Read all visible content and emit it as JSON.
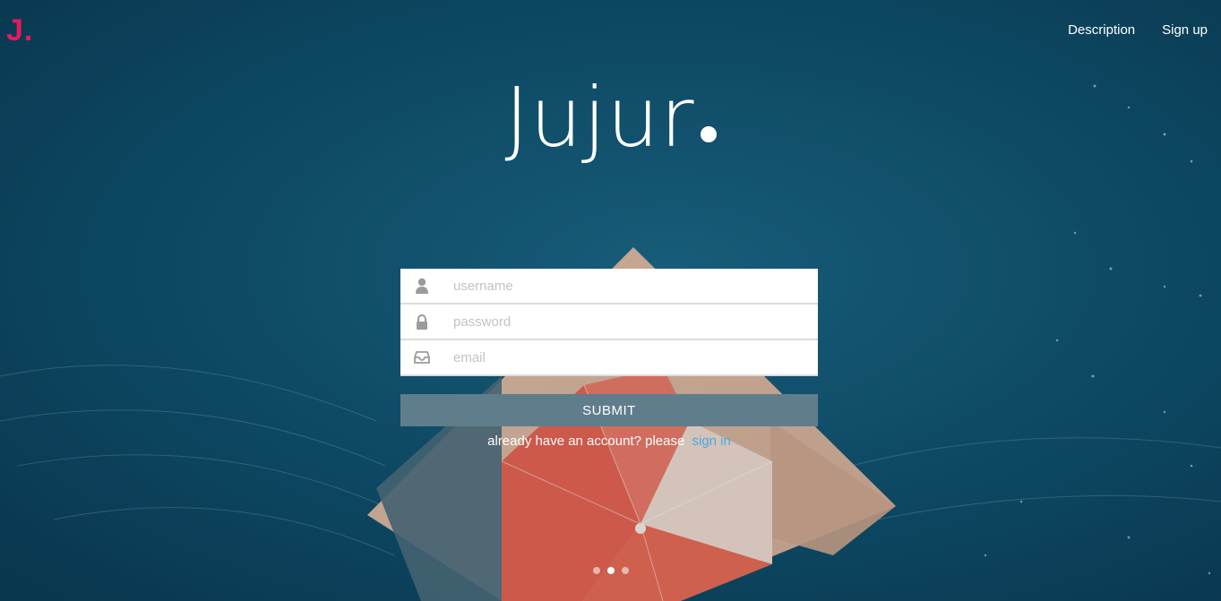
{
  "brand": {
    "logo_text": "J.",
    "accent_color": "#e8185f"
  },
  "nav": {
    "items": [
      "Description",
      "Sign up"
    ]
  },
  "hero": {
    "title": "Jujur"
  },
  "form": {
    "username_placeholder": "username",
    "password_placeholder": "password",
    "email_placeholder": "email",
    "username_icon": "user-icon",
    "password_icon": "lock-icon",
    "email_icon": "inbox-icon",
    "submit_label": "SUBMIT",
    "submit_color": "#607d8b",
    "signin_prompt": "already have an account? please",
    "signin_link": "sign in",
    "link_color": "#4aa8e0"
  },
  "carousel": {
    "slide_count": 3,
    "active_index": 1
  }
}
